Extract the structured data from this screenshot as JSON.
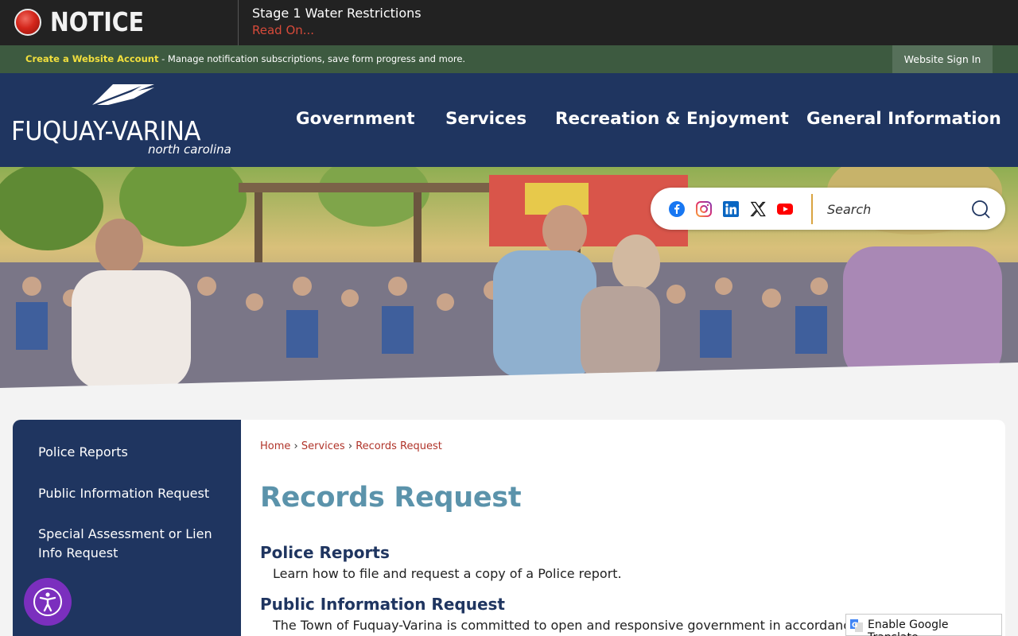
{
  "notice": {
    "title": "NOTICE",
    "message": "Stage 1 Water Restrictions",
    "link": "Read On..."
  },
  "account_bar": {
    "create_link": "Create a Website Account",
    "description": " - Manage notification subscriptions, save form progress and more.",
    "sign_in": "Website Sign In"
  },
  "header": {
    "logo_name": "FUQUAY-VARINA",
    "logo_sub": "north carolina",
    "nav": [
      "Government",
      "Services",
      "Recreation & Enjoyment",
      "General Information"
    ]
  },
  "social": {
    "icons": [
      "facebook-icon",
      "instagram-icon",
      "linkedin-icon",
      "x-icon",
      "youtube-icon"
    ],
    "search_placeholder": "Search"
  },
  "sidebar": {
    "items": [
      "Police Reports",
      "Public Information Request",
      "Special Assessment or Lien Info Request"
    ]
  },
  "breadcrumb": {
    "items": [
      "Home",
      "Services",
      "Records Request"
    ],
    "separator": "›"
  },
  "main": {
    "title": "Records Request",
    "sections": [
      {
        "title": "Police Reports",
        "description": "Learn how to file and request a copy of a Police report."
      },
      {
        "title": "Public Information Request",
        "description": "The Town of Fuquay-Varina is committed to open and responsive government in accordance wit"
      }
    ]
  },
  "translate": {
    "label": "Enable Google Translate"
  },
  "colors": {
    "notice_bg": "#222222",
    "account_bar_bg": "#3d5a40",
    "header_bg": "#1f3560",
    "title_blue": "#5b93ab",
    "link_red": "#b0342a",
    "accessibility_purple": "#7b2fbe"
  }
}
